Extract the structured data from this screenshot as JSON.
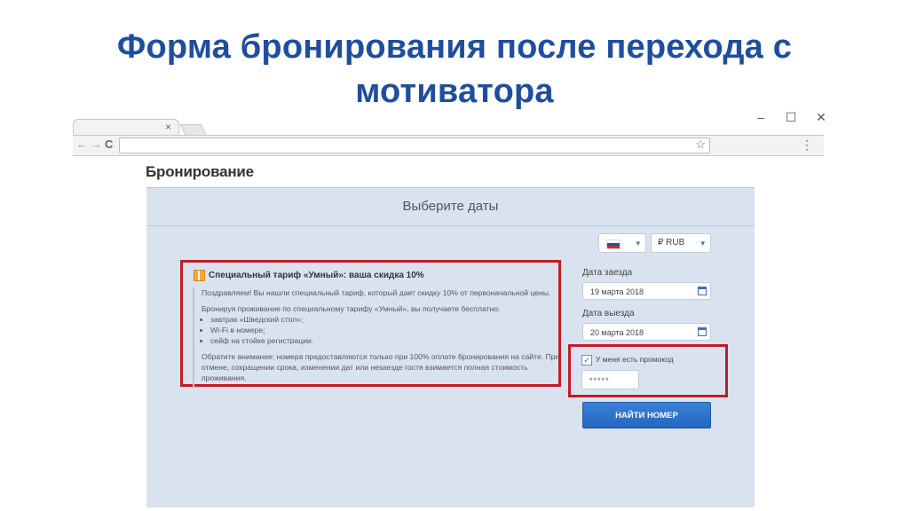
{
  "slide": {
    "title_line1": "Форма бронирования после перехода с",
    "title_line2": "мотиватора"
  },
  "browser": {
    "tab_close": "×",
    "window_controls": [
      "–",
      "☐",
      "✕"
    ],
    "nav": {
      "back": "←",
      "forward": "→",
      "reload": "C"
    },
    "url_value": "",
    "star": "☆",
    "menu": "⋮"
  },
  "page": {
    "heading": "Бронирование",
    "panel_header": "Выберите даты",
    "language_select": {
      "value": "",
      "flag_colors": [
        "#ffffff",
        "#1c4fb3",
        "#d52b1e"
      ],
      "caret": "▾"
    },
    "currency_select": {
      "value": "₽ RUB",
      "caret": "▾"
    },
    "promo": {
      "title": "Специальный тариф «Умный»: ваша скидка 10%",
      "intro": "Поздравляем! Вы нашли специальный тариф, который дает скидку 10% от первоначальной цены.",
      "lead": "Бронируя проживание по специальному тарифу «Умный», вы получаете бесплатно:",
      "benefits": [
        "завтрак «Шведский стол»;",
        "Wi-Fi в номере;",
        "сейф на стойке регистрации."
      ],
      "note": "Обратите внимание: номера предоставляются только при 100% оплате бронирования на сайте. При отмене, сокращении срока, изменении дат или незаезде гостя взимается полная стоимость проживания."
    },
    "checkin": {
      "label": "Дата заезда",
      "value": "19 марта 2018"
    },
    "checkout": {
      "label": "Дата выезда",
      "value": "20 марта 2018"
    },
    "promo_code": {
      "checkbox_label": "У меня есть промокод",
      "checked": "✓",
      "value": "*****"
    },
    "submit_label": "НАЙТИ НОМЕР"
  },
  "colors": {
    "title": "#1f4e9e",
    "highlight_border": "#c41b22",
    "panel_bg": "#d9e3f0",
    "button": "#2a6fcb"
  }
}
